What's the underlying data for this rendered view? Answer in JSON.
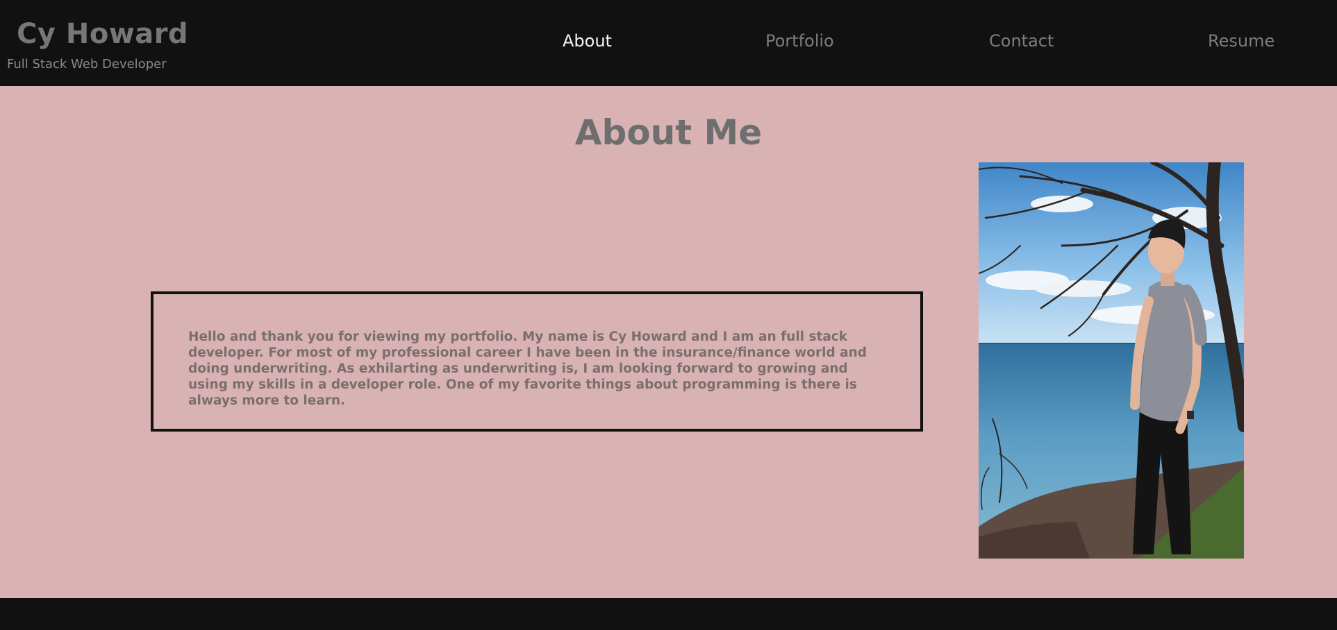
{
  "header": {
    "brand_name": "Cy Howard",
    "tagline": "Full Stack Web Developer",
    "nav": [
      {
        "label": "About",
        "active": true
      },
      {
        "label": "Portfolio",
        "active": false
      },
      {
        "label": "Contact",
        "active": false
      },
      {
        "label": "Resume",
        "active": false
      }
    ]
  },
  "main": {
    "title": "About Me",
    "bio": "Hello and thank you for viewing my portfolio. My name is Cy Howard and I am an full stack developer. For most of my professional career I have been in the insurance/finance world and doing underwriting. As exhilarting as underwriting is, I am looking forward to growing and using my skills in a developer role. One of my favorite things about programming is there is always more to learn."
  },
  "colors": {
    "header_bg": "#111111",
    "main_bg": "#d9b3b3",
    "nav_active": "#f5f5f5",
    "nav_inactive": "#7d7d7d"
  }
}
